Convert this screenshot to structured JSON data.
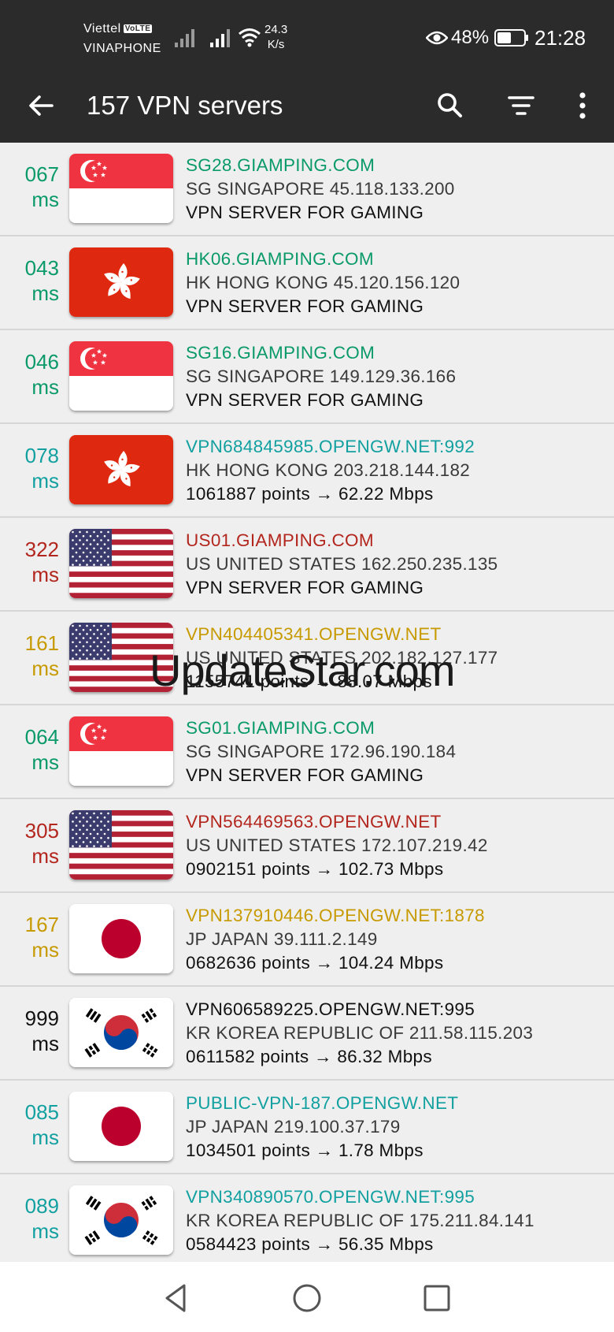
{
  "status_bar": {
    "carrier1": "Viettel",
    "volte": "VoLTE",
    "carrier2": "VINAPHONE",
    "speed_value": "24.3",
    "speed_unit": "K/s",
    "battery": "48%",
    "time": "21:28"
  },
  "toolbar": {
    "title": "157 VPN servers",
    "icons": [
      "back-arrow-icon",
      "search-icon",
      "filter-icon",
      "more-vert-icon"
    ]
  },
  "colors": {
    "green": "#0a9a6a",
    "teal": "#12a0a0",
    "red": "#b3261e",
    "amber": "#c79a00",
    "black": "#111111"
  },
  "servers": [
    {
      "ping": "067",
      "unit": "ms",
      "color": "green",
      "flag": "sg",
      "host": "SG28.GIAMPING.COM",
      "location": "SG SINGAPORE 45.118.133.200",
      "detail": "VPN SERVER FOR GAMING"
    },
    {
      "ping": "043",
      "unit": "ms",
      "color": "green",
      "flag": "hk",
      "host": "HK06.GIAMPING.COM",
      "location": "HK HONG KONG 45.120.156.120",
      "detail": "VPN SERVER FOR GAMING"
    },
    {
      "ping": "046",
      "unit": "ms",
      "color": "green",
      "flag": "sg",
      "host": "SG16.GIAMPING.COM",
      "location": "SG SINGAPORE 149.129.36.166",
      "detail": "VPN SERVER FOR GAMING"
    },
    {
      "ping": "078",
      "unit": "ms",
      "color": "teal",
      "flag": "hk",
      "host": "VPN684845985.OPENGW.NET:992",
      "location": "HK HONG KONG 203.218.144.182",
      "detail": "1061887 points → 62.22 Mbps"
    },
    {
      "ping": "322",
      "unit": "ms",
      "color": "red",
      "flag": "us",
      "host": "US01.GIAMPING.COM",
      "location": "US UNITED STATES 162.250.235.135",
      "detail": "VPN SERVER FOR GAMING"
    },
    {
      "ping": "161",
      "unit": "ms",
      "color": "amber",
      "flag": "us",
      "host": "VPN404405341.OPENGW.NET",
      "location": "US UNITED STATES 202.182.127.177",
      "detail": "1155741 points → 88.07 Mbps"
    },
    {
      "ping": "064",
      "unit": "ms",
      "color": "green",
      "flag": "sg",
      "host": "SG01.GIAMPING.COM",
      "location": "SG SINGAPORE 172.96.190.184",
      "detail": "VPN SERVER FOR GAMING"
    },
    {
      "ping": "305",
      "unit": "ms",
      "color": "red",
      "flag": "us",
      "host": "VPN564469563.OPENGW.NET",
      "location": "US UNITED STATES 172.107.219.42",
      "detail": "0902151 points → 102.73 Mbps"
    },
    {
      "ping": "167",
      "unit": "ms",
      "color": "amber",
      "flag": "jp",
      "host": "VPN137910446.OPENGW.NET:1878",
      "location": "JP JAPAN 39.111.2.149",
      "detail": "0682636 points → 104.24 Mbps"
    },
    {
      "ping": "999",
      "unit": "ms",
      "color": "black",
      "flag": "kr",
      "host": "VPN606589225.OPENGW.NET:995",
      "location": "KR KOREA REPUBLIC OF 211.58.115.203",
      "detail": "0611582 points → 86.32 Mbps"
    },
    {
      "ping": "085",
      "unit": "ms",
      "color": "teal",
      "flag": "jp",
      "host": "PUBLIC-VPN-187.OPENGW.NET",
      "location": "JP JAPAN 219.100.37.179",
      "detail": "1034501 points → 1.78 Mbps"
    },
    {
      "ping": "089",
      "unit": "ms",
      "color": "teal",
      "flag": "kr",
      "host": "VPN340890570.OPENGW.NET:995",
      "location": "KR KOREA REPUBLIC OF 175.211.84.141",
      "detail": "0584423 points → 56.35 Mbps"
    }
  ],
  "watermark": "UpdateStar.com",
  "nav_bar": {
    "icons": [
      "back-triangle-icon",
      "home-circle-icon",
      "recents-square-icon"
    ]
  }
}
